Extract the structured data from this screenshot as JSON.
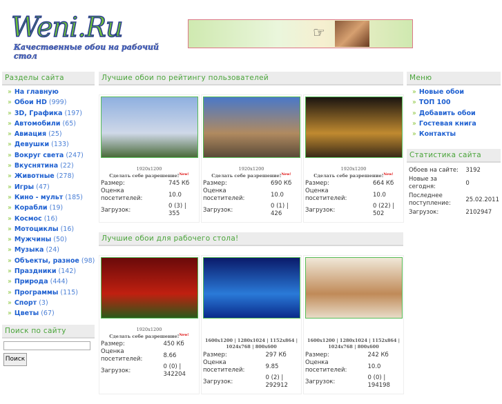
{
  "logo": {
    "title": "Weni.Ru",
    "tagline": "Качественные обои на рабочий стол"
  },
  "left": {
    "sections_title": "Разделы сайта",
    "items": [
      {
        "label": "На главную",
        "count": ""
      },
      {
        "label": "Обои HD",
        "count": "(999)"
      },
      {
        "label": "3D, Графика",
        "count": "(197)"
      },
      {
        "label": "Автомобили",
        "count": "(65)"
      },
      {
        "label": "Авиация",
        "count": "(25)"
      },
      {
        "label": "Девушки",
        "count": "(133)"
      },
      {
        "label": "Вокруг света",
        "count": "(247)"
      },
      {
        "label": "Вкуснятина",
        "count": "(22)"
      },
      {
        "label": "Животные",
        "count": "(278)"
      },
      {
        "label": "Игры",
        "count": "(47)"
      },
      {
        "label": "Кино - мульт",
        "count": "(185)"
      },
      {
        "label": "Корабли",
        "count": "(19)"
      },
      {
        "label": "Космос",
        "count": "(16)"
      },
      {
        "label": "Мотоциклы",
        "count": "(16)"
      },
      {
        "label": "Мужчины",
        "count": "(50)"
      },
      {
        "label": "Музыка",
        "count": "(24)"
      },
      {
        "label": "Объекты, разное",
        "count": "(98)"
      },
      {
        "label": "Праздники",
        "count": "(142)"
      },
      {
        "label": "Природа",
        "count": "(444)"
      },
      {
        "label": "Программы",
        "count": "(115)"
      },
      {
        "label": "Спорт",
        "count": "(3)"
      },
      {
        "label": "Цветы",
        "count": "(67)"
      }
    ],
    "search_title": "Поиск по сайту",
    "search_value": "",
    "search_button": "Поиск"
  },
  "labels": {
    "size": "Размер:",
    "rating": "Оценка посетителей:",
    "downloads": "Загрузок:",
    "make_res": "Сделать себе разрешение!",
    "new": "New!"
  },
  "center": {
    "rating_title": "Лучшие обои по рейтингу пользователей",
    "rating_cards": [
      {
        "res": "1920x1200",
        "size": "745 Кб",
        "rating": "10.0",
        "downloads": "0 (3) | 355",
        "colors": [
          "#8fb0e0",
          "#cfd8e8",
          "#4a6a3a"
        ]
      },
      {
        "res": "1920x1200",
        "size": "690 Кб",
        "rating": "10.0",
        "downloads": "0 (1) | 426",
        "colors": [
          "#4a78c8",
          "#b08a60",
          "#5a4a38"
        ]
      },
      {
        "res": "1920x1200",
        "size": "664 Кб",
        "rating": "10.0",
        "downloads": "0 (22) | 502",
        "colors": [
          "#1a1410",
          "#c08a30",
          "#3a2a18"
        ]
      }
    ],
    "desktop_title": "Лучшие обои для рабочего стола!",
    "desktop_cards": [
      {
        "res": "1920x1200",
        "size": "450 Кб",
        "rating": "8.66",
        "downloads": "0 (0) | 342204",
        "colors": [
          "#6a0a0a",
          "#c02010",
          "#2a5a1a"
        ]
      },
      {
        "res": "1600x1200 | 1280x1024 | 1152x864 | 1024x768 | 800x600",
        "size": "297 Кб",
        "rating": "9.85",
        "downloads": "0 (2) | 292912",
        "colors": [
          "#0a1a6a",
          "#2a7ad8",
          "#0a2a8a"
        ]
      },
      {
        "res": "1600x1200 | 1280x1024 | 1152x864 | 1024x768 | 800x600",
        "size": "242 Кб",
        "rating": "10.0",
        "downloads": "0 (0) | 194198",
        "colors": [
          "#f0e8d8",
          "#c08a58",
          "#e8dcc8"
        ]
      }
    ]
  },
  "right": {
    "menu_title": "Меню",
    "menu": [
      "Новые обои",
      "ТОП 100",
      "Добавить обои",
      "Гостевая книга",
      "Контакты"
    ],
    "stats_title": "Статистика сайта",
    "stats": [
      {
        "label": "Обоев на сайте:",
        "value": "3192"
      },
      {
        "label": "Новые за сегодня:",
        "value": "0"
      },
      {
        "label": "Последнее поступление:",
        "value": "25.02.2011"
      },
      {
        "label": "Загрузок:",
        "value": "2102947"
      }
    ]
  }
}
